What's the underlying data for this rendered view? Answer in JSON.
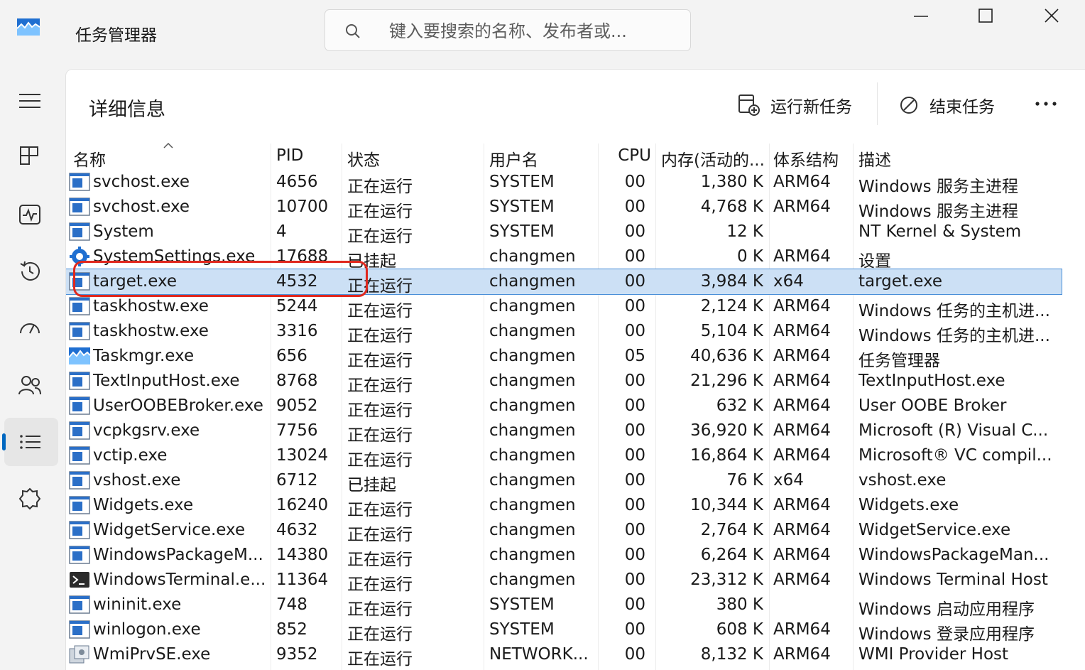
{
  "app": {
    "title": "任务管理器",
    "icon": "taskmgr-graph-icon"
  },
  "search": {
    "placeholder": "键入要搜索的名称、发布者或..."
  },
  "window_controls": [
    "minimize",
    "maximize",
    "close"
  ],
  "nav": {
    "items": [
      {
        "name": "menu",
        "icon": "hamburger-icon"
      },
      {
        "name": "processes",
        "icon": "processes-grid-icon"
      },
      {
        "name": "performance",
        "icon": "performance-pulse-icon"
      },
      {
        "name": "app-history",
        "icon": "history-clock-icon"
      },
      {
        "name": "startup",
        "icon": "speedometer-icon"
      },
      {
        "name": "users",
        "icon": "users-icon"
      },
      {
        "name": "details",
        "icon": "details-list-icon",
        "active": true
      },
      {
        "name": "services",
        "icon": "puzzle-gear-icon"
      }
    ]
  },
  "page": {
    "title": "详细信息"
  },
  "commands": {
    "run_new_task": "运行新任务",
    "end_task": "结束任务",
    "more": "···"
  },
  "columns": [
    "名称",
    "PID",
    "状态",
    "用户名",
    "CPU",
    "内存(活动的...",
    "体系结构",
    "描述"
  ],
  "rows": [
    {
      "name": "svchost.exe",
      "pid": "4656",
      "status": "正在运行",
      "user": "SYSTEM",
      "cpu": "00",
      "mem": "1,380 K",
      "arch": "ARM64",
      "desc": "Windows 服务主进程",
      "icon": "generic-exe-icon"
    },
    {
      "name": "svchost.exe",
      "pid": "10700",
      "status": "正在运行",
      "user": "SYSTEM",
      "cpu": "00",
      "mem": "4,768 K",
      "arch": "ARM64",
      "desc": "Windows 服务主进程",
      "icon": "generic-exe-icon"
    },
    {
      "name": "System",
      "pid": "4",
      "status": "正在运行",
      "user": "SYSTEM",
      "cpu": "00",
      "mem": "12 K",
      "arch": "",
      "desc": "NT Kernel & System",
      "icon": "generic-exe-icon"
    },
    {
      "name": "SystemSettings.exe",
      "pid": "17688",
      "status": "已挂起",
      "user": "changmen",
      "cpu": "00",
      "mem": "0 K",
      "arch": "ARM64",
      "desc": "设置",
      "icon": "settings-gear-icon"
    },
    {
      "name": "target.exe",
      "pid": "4532",
      "status": "正在运行",
      "user": "changmen",
      "cpu": "00",
      "mem": "3,984 K",
      "arch": "x64",
      "desc": "target.exe",
      "icon": "generic-exe-icon",
      "selected": true
    },
    {
      "name": "taskhostw.exe",
      "pid": "5244",
      "status": "正在运行",
      "user": "changmen",
      "cpu": "00",
      "mem": "2,124 K",
      "arch": "ARM64",
      "desc": "Windows 任务的主机进...",
      "icon": "generic-exe-icon"
    },
    {
      "name": "taskhostw.exe",
      "pid": "3316",
      "status": "正在运行",
      "user": "changmen",
      "cpu": "00",
      "mem": "5,104 K",
      "arch": "ARM64",
      "desc": "Windows 任务的主机进...",
      "icon": "generic-exe-icon"
    },
    {
      "name": "Taskmgr.exe",
      "pid": "656",
      "status": "正在运行",
      "user": "changmen",
      "cpu": "05",
      "mem": "40,636 K",
      "arch": "ARM64",
      "desc": "任务管理器",
      "icon": "taskmgr-graph-icon"
    },
    {
      "name": "TextInputHost.exe",
      "pid": "8768",
      "status": "正在运行",
      "user": "changmen",
      "cpu": "00",
      "mem": "21,296 K",
      "arch": "ARM64",
      "desc": "TextInputHost.exe",
      "icon": "generic-exe-icon"
    },
    {
      "name": "UserOOBEBroker.exe",
      "pid": "9052",
      "status": "正在运行",
      "user": "changmen",
      "cpu": "00",
      "mem": "632 K",
      "arch": "ARM64",
      "desc": "User OOBE Broker",
      "icon": "generic-exe-icon"
    },
    {
      "name": "vcpkgsrv.exe",
      "pid": "7756",
      "status": "正在运行",
      "user": "changmen",
      "cpu": "00",
      "mem": "36,920 K",
      "arch": "ARM64",
      "desc": "Microsoft (R) Visual C...",
      "icon": "generic-exe-icon"
    },
    {
      "name": "vctip.exe",
      "pid": "13024",
      "status": "正在运行",
      "user": "changmen",
      "cpu": "00",
      "mem": "16,864 K",
      "arch": "ARM64",
      "desc": "Microsoft® VC compil...",
      "icon": "generic-exe-icon"
    },
    {
      "name": "vshost.exe",
      "pid": "6712",
      "status": "已挂起",
      "user": "changmen",
      "cpu": "00",
      "mem": "76 K",
      "arch": "x64",
      "desc": "vshost.exe",
      "icon": "generic-exe-icon"
    },
    {
      "name": "Widgets.exe",
      "pid": "16240",
      "status": "正在运行",
      "user": "changmen",
      "cpu": "00",
      "mem": "10,344 K",
      "arch": "ARM64",
      "desc": "Widgets.exe",
      "icon": "generic-exe-icon"
    },
    {
      "name": "WidgetService.exe",
      "pid": "4632",
      "status": "正在运行",
      "user": "changmen",
      "cpu": "00",
      "mem": "2,764 K",
      "arch": "ARM64",
      "desc": "WidgetService.exe",
      "icon": "generic-exe-icon"
    },
    {
      "name": "WindowsPackageM...",
      "pid": "14380",
      "status": "正在运行",
      "user": "changmen",
      "cpu": "00",
      "mem": "6,264 K",
      "arch": "ARM64",
      "desc": "WindowsPackageMan...",
      "icon": "generic-exe-icon"
    },
    {
      "name": "WindowsTerminal.e...",
      "pid": "11364",
      "status": "正在运行",
      "user": "changmen",
      "cpu": "00",
      "mem": "23,312 K",
      "arch": "ARM64",
      "desc": "Windows Terminal Host",
      "icon": "terminal-icon"
    },
    {
      "name": "wininit.exe",
      "pid": "748",
      "status": "正在运行",
      "user": "SYSTEM",
      "cpu": "00",
      "mem": "380 K",
      "arch": "",
      "desc": "Windows 启动应用程序",
      "icon": "generic-exe-icon"
    },
    {
      "name": "winlogon.exe",
      "pid": "852",
      "status": "正在运行",
      "user": "SYSTEM",
      "cpu": "00",
      "mem": "608 K",
      "arch": "ARM64",
      "desc": "Windows 登录应用程序",
      "icon": "generic-exe-icon"
    },
    {
      "name": "WmiPrvSE.exe",
      "pid": "9352",
      "status": "正在运行",
      "user": "NETWORK...",
      "cpu": "00",
      "mem": "8,132 K",
      "arch": "ARM64",
      "desc": "WMI Provider Host",
      "icon": "wmi-icon"
    }
  ],
  "colors": {
    "accent": "#0067c0",
    "selection": "#cce0f5",
    "annotation": "#e0281e"
  }
}
